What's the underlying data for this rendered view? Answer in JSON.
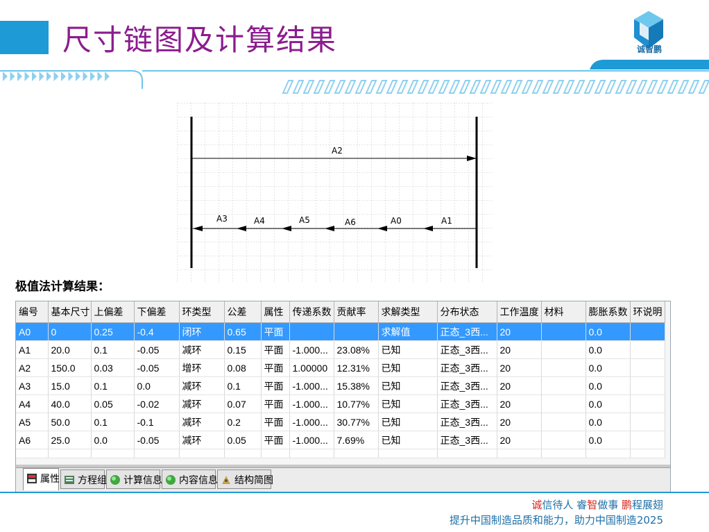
{
  "title": "尺寸链图及计算结果",
  "logo_text": "诚智鹏",
  "diagram": {
    "top_label": "A2",
    "chain_labels": [
      "A3",
      "A4",
      "A5",
      "A6",
      "A0",
      "A1"
    ]
  },
  "result_heading": "极值法计算结果：",
  "table": {
    "headers": [
      "编号",
      "基本尺寸",
      "上偏差",
      "下偏差",
      "环类型",
      "公差",
      "属性",
      "传递系数",
      "贡献率",
      "求解类型",
      "分布状态",
      "工作温度",
      "材料",
      "膨胀系数",
      "环说明"
    ],
    "rows": [
      [
        "A0",
        "0",
        "0.25",
        "-0.4",
        "闭环",
        "0.65",
        "平面",
        "",
        "",
        "求解值",
        "正态_3西...",
        "20",
        "",
        "0.0",
        ""
      ],
      [
        "A1",
        "20.0",
        "0.1",
        "-0.05",
        "减环",
        "0.15",
        "平面",
        "-1.000...",
        "23.08%",
        "已知",
        "正态_3西...",
        "20",
        "",
        "0.0",
        ""
      ],
      [
        "A2",
        "150.0",
        "0.03",
        "-0.05",
        "增环",
        "0.08",
        "平面",
        "1.00000",
        "12.31%",
        "已知",
        "正态_3西...",
        "20",
        "",
        "0.0",
        ""
      ],
      [
        "A3",
        "15.0",
        "0.1",
        "0.0",
        "减环",
        "0.1",
        "平面",
        "-1.000...",
        "15.38%",
        "已知",
        "正态_3西...",
        "20",
        "",
        "0.0",
        ""
      ],
      [
        "A4",
        "40.0",
        "0.05",
        "-0.02",
        "减环",
        "0.07",
        "平面",
        "-1.000...",
        "10.77%",
        "已知",
        "正态_3西...",
        "20",
        "",
        "0.0",
        ""
      ],
      [
        "A5",
        "50.0",
        "0.1",
        "-0.1",
        "减环",
        "0.2",
        "平面",
        "-1.000...",
        "30.77%",
        "已知",
        "正态_3西...",
        "20",
        "",
        "0.0",
        ""
      ],
      [
        "A6",
        "25.0",
        "0.0",
        "-0.05",
        "减环",
        "0.05",
        "平面",
        "-1.000...",
        "7.69%",
        "已知",
        "正态_3西...",
        "20",
        "",
        "0.0",
        ""
      ]
    ],
    "selected_row": 0
  },
  "tabs": [
    {
      "label": "属性",
      "icon": "properties-icon"
    },
    {
      "label": "方程组",
      "icon": "equations-icon"
    },
    {
      "label": "计算信息",
      "icon": "green-orb-icon"
    },
    {
      "label": "内容信息",
      "icon": "green-orb-icon"
    },
    {
      "label": "结构简图",
      "icon": "structure-icon"
    }
  ],
  "footer": {
    "line1": [
      {
        "t": "诚",
        "c": "red"
      },
      {
        "t": "信待人 ",
        "c": "blue"
      },
      {
        "t": "睿",
        "c": "blue"
      },
      {
        "t": "智",
        "c": "red"
      },
      {
        "t": "做事 ",
        "c": "blue"
      },
      {
        "t": "鹏",
        "c": "red"
      },
      {
        "t": "程展翅",
        "c": "blue"
      }
    ],
    "line2": "提升中国制造品质和能力，助力中国制造2025"
  },
  "colors": {
    "accent": "#1e9ad6",
    "title": "#8b1c8e",
    "selection": "#3399ff",
    "footer_red": "#d9251d"
  }
}
